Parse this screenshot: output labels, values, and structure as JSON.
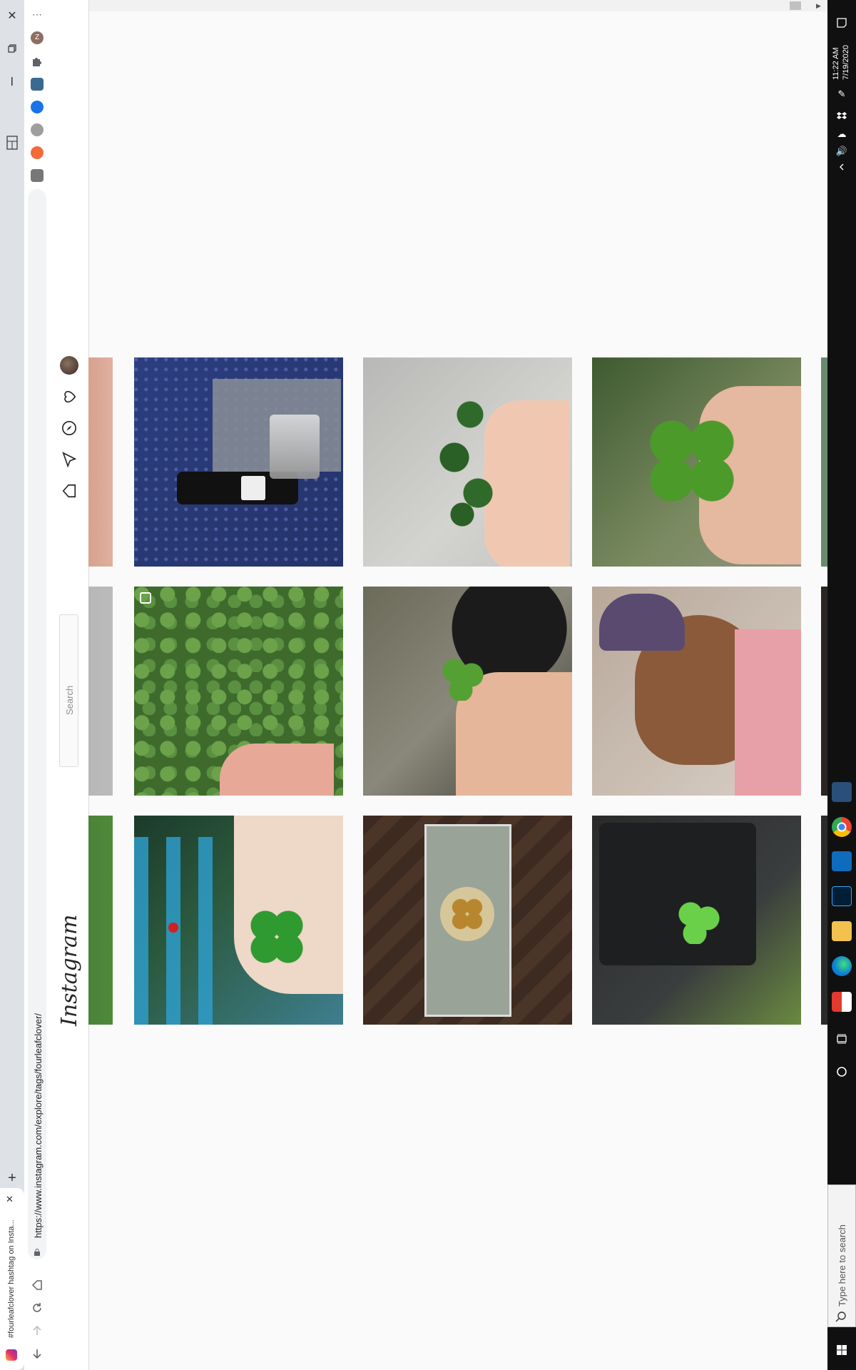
{
  "browser": {
    "tab_title": "#fourleafclover hashtag on Insta...",
    "url": "https://www.instagram.com/explore/tags/fourleafclover/",
    "menu_glyph": "⋯",
    "new_tab_glyph": "+",
    "close_tab_glyph": "✕",
    "profile_initial": "Z"
  },
  "instagram": {
    "logo": "Instagram",
    "search_placeholder": "Search",
    "posts": [
      {
        "id": "p1",
        "desc": "gin bottle on floral fabric"
      },
      {
        "id": "p2",
        "desc": "hand holding clover on concrete"
      },
      {
        "id": "p3",
        "desc": "hand holding four leaf clover"
      },
      {
        "id": "p4",
        "desc": "clover patch with flowers"
      },
      {
        "id": "p5",
        "desc": "clover in hand over rock"
      },
      {
        "id": "p6",
        "desc": "man selfie"
      },
      {
        "id": "p7",
        "desc": "hand with clover over blue fence"
      },
      {
        "id": "p8",
        "desc": "million dollar bill with clover"
      },
      {
        "id": "p9",
        "desc": "clover on black leather bag"
      }
    ]
  },
  "taskbar": {
    "time": "11:22 AM",
    "date": "7/19/2020",
    "search_placeholder": "Type here to search"
  },
  "colors": {
    "instagram_bg": "#fafafa",
    "taskbar_bg": "#101010",
    "tabstrip_bg": "#dee1e6"
  }
}
